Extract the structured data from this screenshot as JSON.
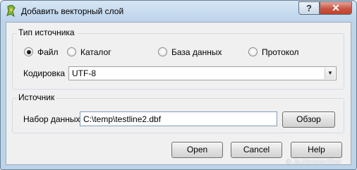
{
  "window": {
    "title": "Добавить векторный слой",
    "help_glyph": "?",
    "close_glyph": "✕",
    "app_icon": "qgis-icon"
  },
  "source_type": {
    "title": "Тип источника",
    "options": [
      {
        "label": "Файл",
        "checked": true
      },
      {
        "label": "Каталог",
        "checked": false
      },
      {
        "label": "База данных",
        "checked": false
      },
      {
        "label": "Протокол",
        "checked": false
      }
    ],
    "encoding_label": "Кодировка",
    "encoding_value": "UTF-8",
    "dropdown_icon": "chevron-down-icon"
  },
  "source": {
    "title": "Источник",
    "dataset_label": "Набор данных",
    "dataset_value": "C:\\temp\\testline2.dbf",
    "browse_label": "Обзор"
  },
  "buttons": {
    "open": "Open",
    "cancel": "Cancel",
    "help": "Help"
  },
  "watermark": "© JoJScreenShot"
}
